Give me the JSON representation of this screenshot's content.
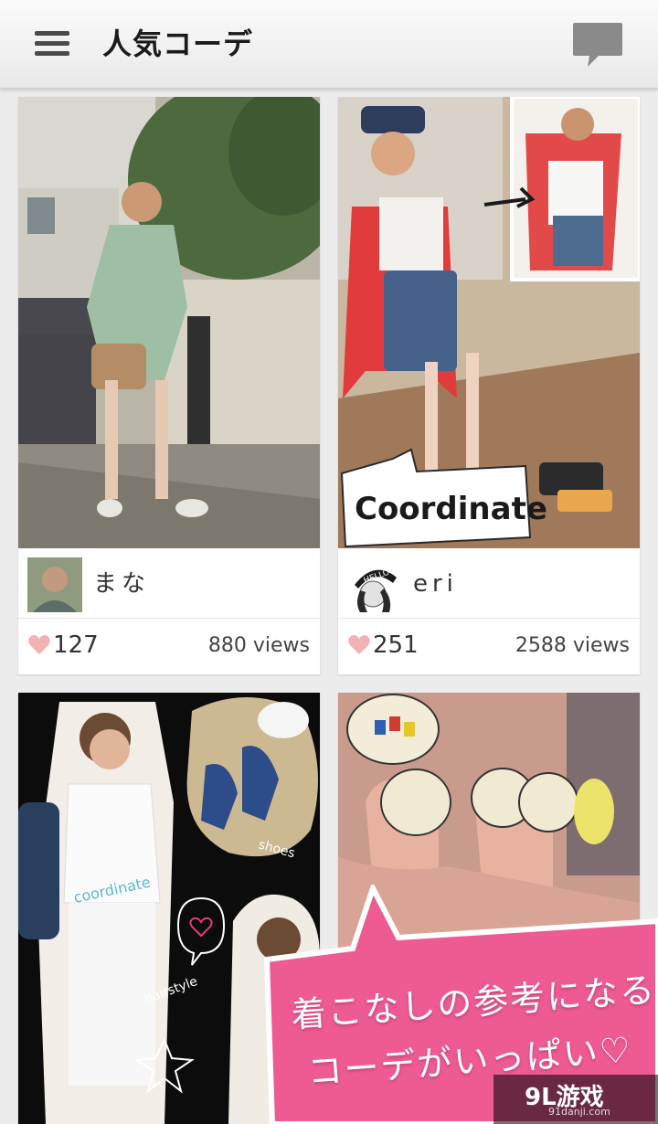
{
  "header": {
    "title": "人気コーデ",
    "menu_icon": "menu-icon",
    "chat_icon": "speech-bubble-icon"
  },
  "cards": [
    {
      "username": "まな",
      "likes": "127",
      "views": "880 views"
    },
    {
      "username": "eri",
      "likes": "251",
      "views": "2588 views",
      "photo_badge": "Coordinate",
      "avatar_text": "HELLO"
    },
    {
      "photo_texts": [
        "coordinate",
        "shoes",
        "hairstyle"
      ]
    },
    {}
  ],
  "promo": {
    "line1": "着こなしの参考になる",
    "line2": "コーデがいっぱい♡",
    "color": "#ee5a92"
  },
  "watermark": {
    "logo": "9L游戏",
    "url": "91danji.com"
  },
  "colors": {
    "heart": "#f3b1b1",
    "promo_pink": "#ee5a92",
    "appbar": "#f2f2f2"
  }
}
